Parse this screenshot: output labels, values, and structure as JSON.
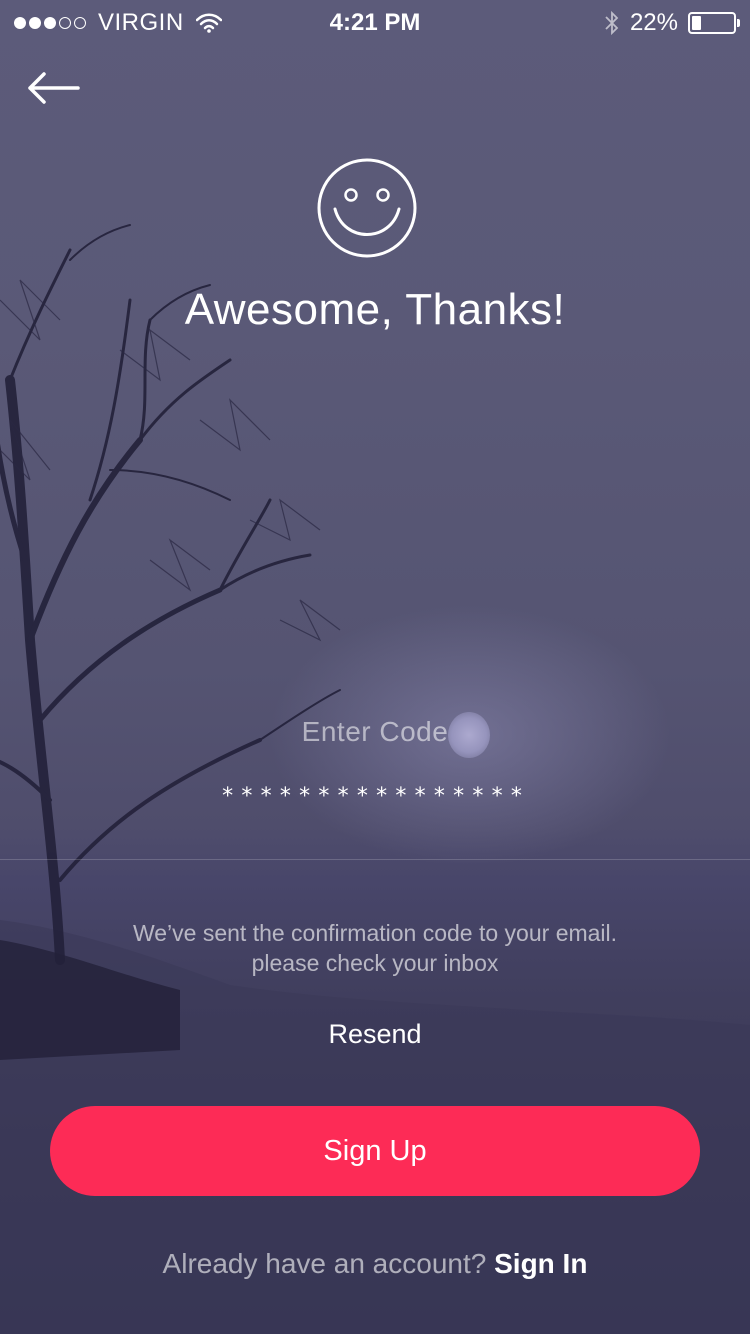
{
  "status_bar": {
    "carrier": "VIRGIN",
    "time": "4:21 PM",
    "battery_percent": "22%",
    "battery_level": 0.22,
    "signal_bars_filled": 3,
    "signal_bars_total": 5,
    "icons": [
      "wifi-icon",
      "bluetooth-icon",
      "battery-icon"
    ]
  },
  "header": {
    "back_icon": "arrow-left-icon"
  },
  "hero": {
    "icon": "smiley-face-icon",
    "title": "Awesome, Thanks!"
  },
  "code_form": {
    "label": "Enter Code",
    "value": "****************",
    "info_line_1": "We’ve sent the confirmation code to your email.",
    "info_line_2": "please check your inbox",
    "resend_label": "Resend"
  },
  "actions": {
    "signup_label": "Sign Up",
    "footer_prompt": "Already have an account?",
    "signin_label": "Sign In"
  },
  "colors": {
    "accent": "#fd2b56",
    "background": "#5a5977"
  }
}
